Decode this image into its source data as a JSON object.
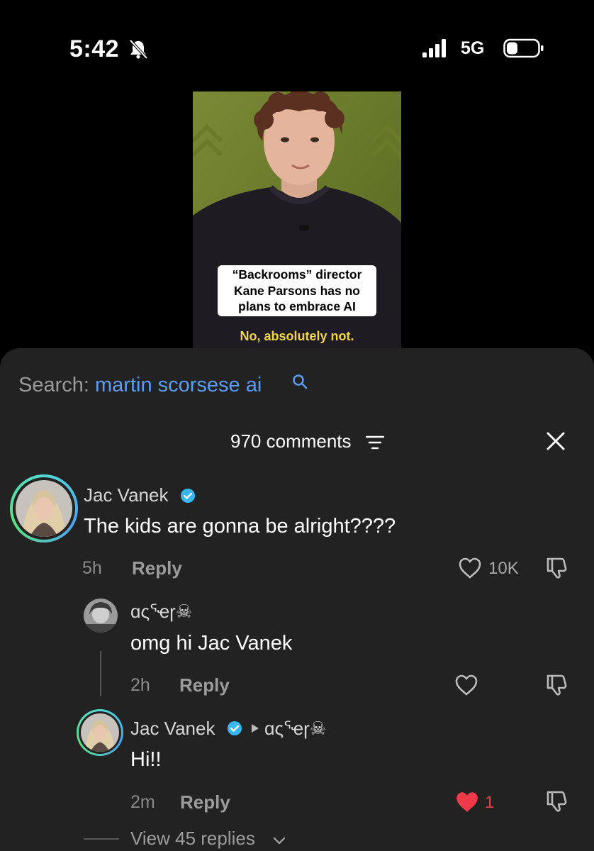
{
  "status_bar": {
    "time": "5:42",
    "network": "5G",
    "icons": [
      "bell-slash-icon",
      "signal-icon",
      "battery-icon"
    ]
  },
  "video": {
    "caption": "“Backrooms” director Kane Parsons has no plans to embrace AI",
    "subtitle": "No, absolutely not."
  },
  "search": {
    "label": "Search:",
    "query": "martin scorsese ai"
  },
  "comments_header": {
    "count_label": "970 comments"
  },
  "comments": [
    {
      "author": "Jac Vanek",
      "verified": true,
      "text": "The kids are gonna be alright????",
      "age": "5h",
      "reply_label": "Reply",
      "likes": "10K",
      "replies": [
        {
          "author": "ɑςᕐҽɼ☠",
          "text": "omg hi Jac Vanek",
          "age": "2h",
          "reply_label": "Reply",
          "likes": ""
        },
        {
          "author": "Jac Vanek",
          "verified": true,
          "reply_to": "ɑςᕐҽɼ☠",
          "text": "Hi!!",
          "age": "2m",
          "reply_label": "Reply",
          "likes": "1",
          "liked": true
        }
      ],
      "view_replies_label": "View 45 replies"
    }
  ],
  "colors": {
    "sheet_bg": "#222222",
    "search_query": "#5b9cf5",
    "verified": "#38b6f5",
    "liked": "#f03a4a",
    "subtitle": "#f0d44a"
  }
}
